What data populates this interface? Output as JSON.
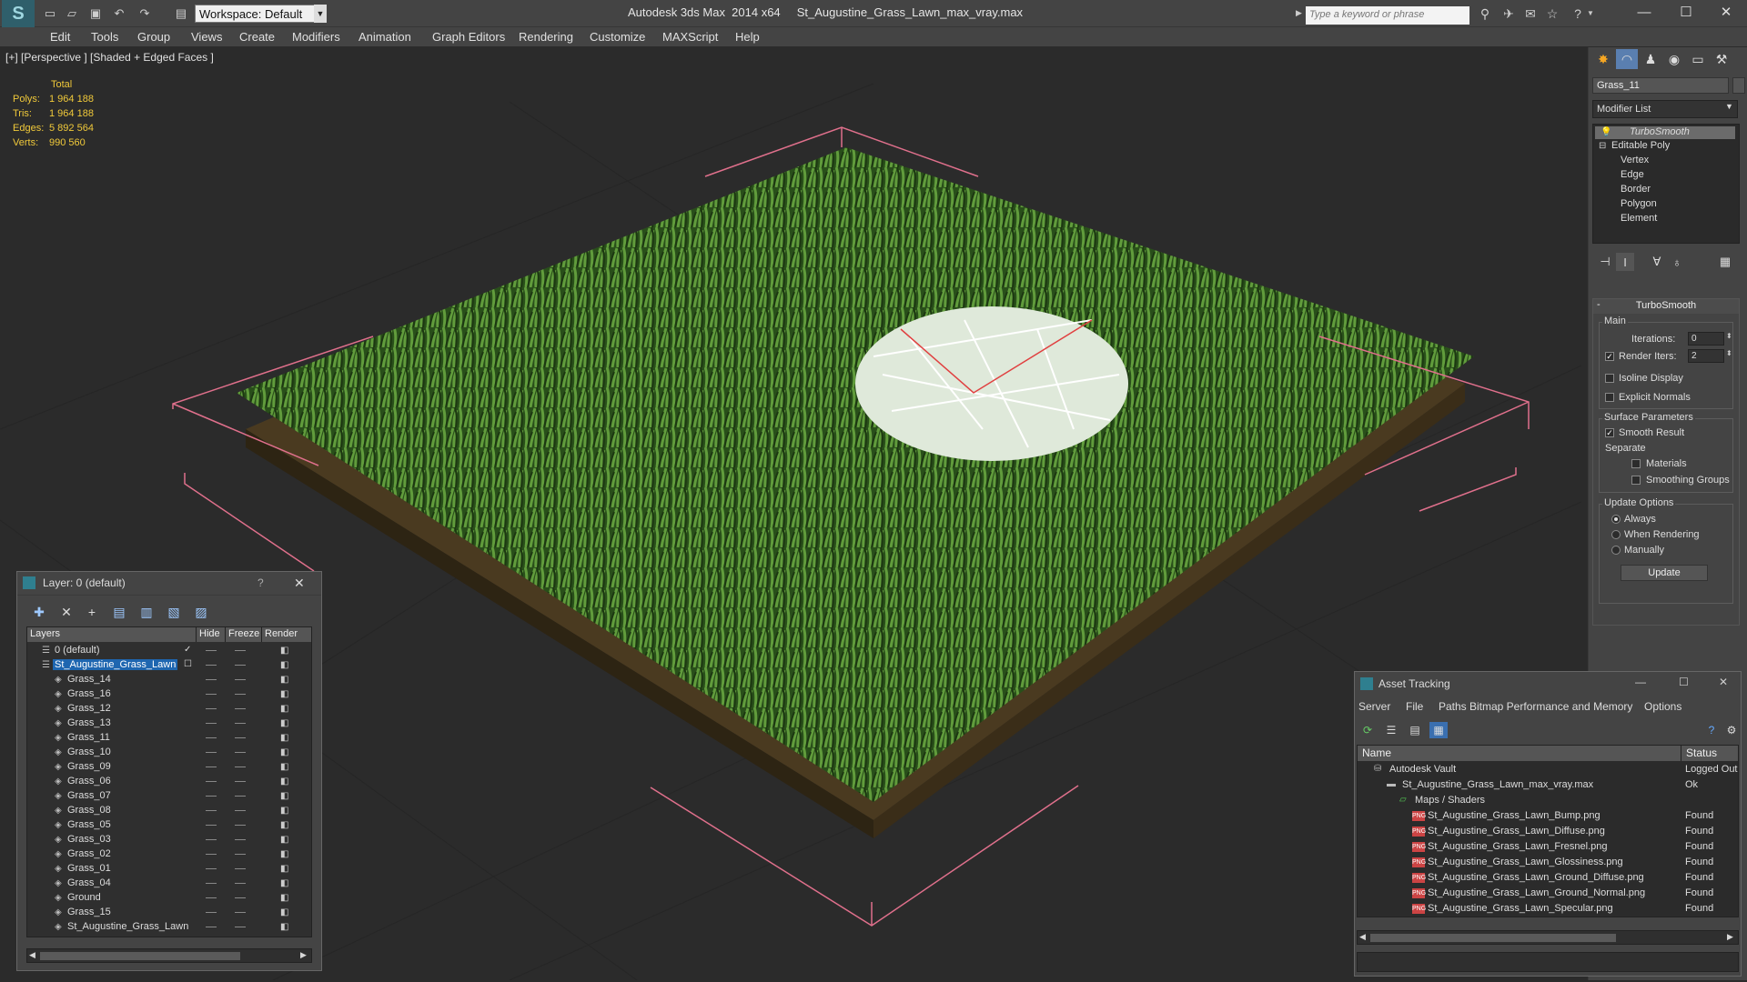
{
  "titlebar": {
    "workspace": "Workspace: Default",
    "title": "Autodesk 3ds Max  2014 x64     St_Augustine_Grass_Lawn_max_vray.max",
    "search_placeholder": "Type a keyword or phrase"
  },
  "menu": [
    "Edit",
    "Tools",
    "Group",
    "Views",
    "Create",
    "Modifiers",
    "Animation",
    "Graph Editors",
    "Rendering",
    "Customize",
    "MAXScript",
    "Help"
  ],
  "viewport": {
    "label": "[+] [Perspective ] [Shaded + Edged Faces ]",
    "stats": {
      "header": "Total",
      "rows": [
        {
          "label": "Polys:",
          "value": "1 964 188"
        },
        {
          "label": "Tris:",
          "value": "1 964 188"
        },
        {
          "label": "Edges:",
          "value": "5 892 564"
        },
        {
          "label": "Verts:",
          "value": "990 560"
        }
      ]
    }
  },
  "command_panel": {
    "object_name": "Grass_11",
    "modifier_list": "Modifier List",
    "stack": [
      "TurboSmooth",
      "Editable Poly",
      "Vertex",
      "Edge",
      "Border",
      "Polygon",
      "Element"
    ],
    "rollout_title": "TurboSmooth",
    "main_label": "Main",
    "iterations_label": "Iterations:",
    "iterations_value": "0",
    "render_iters_label": "Render Iters:",
    "render_iters_value": "2",
    "isoline": "Isoline Display",
    "explicit_normals": "Explicit Normals",
    "surface_params": "Surface Parameters",
    "smooth_result": "Smooth Result",
    "separate": "Separate",
    "materials": "Materials",
    "smoothing_groups": "Smoothing Groups",
    "update_options": "Update Options",
    "always": "Always",
    "when_rendering": "When Rendering",
    "manually": "Manually",
    "update_button": "Update"
  },
  "layer_dialog": {
    "title": "Layer: 0 (default)",
    "help": "?",
    "columns": [
      "Layers",
      "Hide",
      "Freeze",
      "Render"
    ],
    "rows": [
      {
        "name": "0 (default)",
        "indent": 1
      },
      {
        "name": "St_Augustine_Grass_Lawn",
        "indent": 1
      },
      {
        "name": "Grass_14",
        "indent": 2
      },
      {
        "name": "Grass_16",
        "indent": 2
      },
      {
        "name": "Grass_12",
        "indent": 2
      },
      {
        "name": "Grass_13",
        "indent": 2
      },
      {
        "name": "Grass_11",
        "indent": 2
      },
      {
        "name": "Grass_10",
        "indent": 2
      },
      {
        "name": "Grass_09",
        "indent": 2
      },
      {
        "name": "Grass_06",
        "indent": 2
      },
      {
        "name": "Grass_07",
        "indent": 2
      },
      {
        "name": "Grass_08",
        "indent": 2
      },
      {
        "name": "Grass_05",
        "indent": 2
      },
      {
        "name": "Grass_03",
        "indent": 2
      },
      {
        "name": "Grass_02",
        "indent": 2
      },
      {
        "name": "Grass_01",
        "indent": 2
      },
      {
        "name": "Grass_04",
        "indent": 2
      },
      {
        "name": "Ground",
        "indent": 2
      },
      {
        "name": "Grass_15",
        "indent": 2
      },
      {
        "name": "St_Augustine_Grass_Lawn",
        "indent": 2
      }
    ]
  },
  "asset_dialog": {
    "title": "Asset Tracking",
    "menu": [
      "Server",
      "File",
      "Paths",
      "Bitmap Performance and Memory",
      "Options"
    ],
    "columns": [
      "Name",
      "Status"
    ],
    "rows": [
      {
        "name": "Autodesk Vault",
        "status": "Logged Out",
        "level": 0,
        "icon": "vault-icon"
      },
      {
        "name": "St_Augustine_Grass_Lawn_max_vray.max",
        "status": "Ok",
        "level": 1,
        "icon": "max-file-icon"
      },
      {
        "name": "Maps / Shaders",
        "status": "",
        "level": 2,
        "icon": "maps-icon"
      },
      {
        "name": "St_Augustine_Grass_Lawn_Bump.png",
        "status": "Found",
        "level": 3,
        "icon": "png-icon"
      },
      {
        "name": "St_Augustine_Grass_Lawn_Diffuse.png",
        "status": "Found",
        "level": 3,
        "icon": "png-icon"
      },
      {
        "name": "St_Augustine_Grass_Lawn_Fresnel.png",
        "status": "Found",
        "level": 3,
        "icon": "png-icon"
      },
      {
        "name": "St_Augustine_Grass_Lawn_Glossiness.png",
        "status": "Found",
        "level": 3,
        "icon": "png-icon"
      },
      {
        "name": "St_Augustine_Grass_Lawn_Ground_Diffuse.png",
        "status": "Found",
        "level": 3,
        "icon": "png-icon"
      },
      {
        "name": "St_Augustine_Grass_Lawn_Ground_Normal.png",
        "status": "Found",
        "level": 3,
        "icon": "png-icon"
      },
      {
        "name": "St_Augustine_Grass_Lawn_Specular.png",
        "status": "Found",
        "level": 3,
        "icon": "png-icon"
      }
    ],
    "png_badge": "PNG"
  },
  "colors": {
    "selection_blue": "#1e66b0",
    "stats_yellow": "#f0c93a",
    "grass_green": "#4a8a2e",
    "bbox_pink": "#e0708c"
  }
}
